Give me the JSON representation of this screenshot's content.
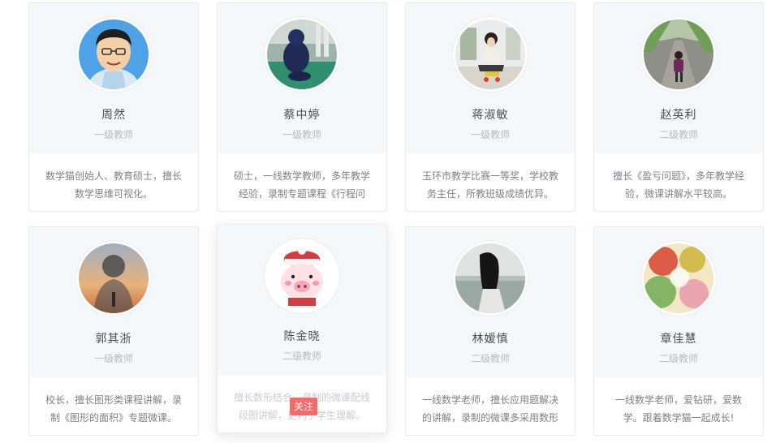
{
  "teachers": [
    {
      "name": "周然",
      "title": "一级教师",
      "desc": "数学猫创始人、教育硕士，擅长数学思维可视化。"
    },
    {
      "name": "蔡中婷",
      "title": "一级教师",
      "desc": "硕士，一线数学教师，多年教学经验，录制专题课程《行程问"
    },
    {
      "name": "蒋淑敏",
      "title": "一级教师",
      "desc": "玉环市教学比赛一等奖，学校教务主任，所教班级成绩优异。"
    },
    {
      "name": "赵英利",
      "title": "二级教师",
      "desc": "擅长《盈亏问题》，多年教学经验，微课讲解水平较高。"
    },
    {
      "name": "郭其浙",
      "title": "一级教师",
      "desc": "校长，擅长图形类课程讲解，录制《图形的面积》专题微课。"
    },
    {
      "name": "陈金晓",
      "title": "二级教师",
      "desc": "擅长数形结合，录制的微课配线段图讲解，更利于学生理解。"
    },
    {
      "name": "林嫒慎",
      "title": "二级教师",
      "desc": "一线数学老师，擅长应用题解决的讲解，录制的微课多采用数形"
    },
    {
      "name": "章佳慧",
      "title": "二级教师",
      "desc": "一线数学老师，爱钻研，爱数学。跟着数学猫一起成长!"
    }
  ],
  "follow_label": "关注",
  "colors": {
    "accent": "#f36c6c",
    "card_top_bg": "#f5f8fb",
    "name_text": "#4a4f55",
    "title_text": "#b5bcc3",
    "desc_text": "#7c8289"
  },
  "avatar_icons": [
    "cartoon-man-avatar-icon",
    "child-photo-avatar-icon",
    "woman-sitting-avatar-icon",
    "girl-walking-avatar-icon",
    "silhouette-sunset-avatar-icon",
    "cartoon-pig-avatar-icon",
    "woman-seaside-avatar-icon",
    "colorful-paint-avatar-icon"
  ]
}
